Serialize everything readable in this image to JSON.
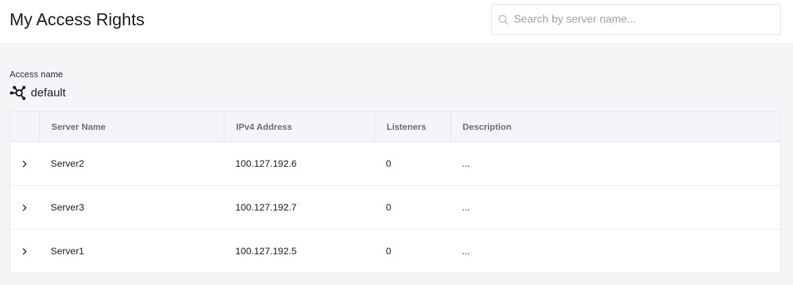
{
  "header": {
    "title": "My Access Rights",
    "search": {
      "placeholder": "Search by server name...",
      "value": "",
      "icon": "search-icon"
    }
  },
  "access": {
    "label": "Access name",
    "value": "default",
    "icon": "network-icon"
  },
  "table": {
    "columns": [
      "",
      "Server Name",
      "IPv4 Address",
      "Listeners",
      "Description"
    ],
    "rows": [
      {
        "name": "Server2",
        "ip": "100.127.192.6",
        "listeners": "0",
        "description": "..."
      },
      {
        "name": "Server3",
        "ip": "100.127.192.7",
        "listeners": "0",
        "description": "..."
      },
      {
        "name": "Server1",
        "ip": "100.127.192.5",
        "listeners": "0",
        "description": "..."
      }
    ]
  }
}
